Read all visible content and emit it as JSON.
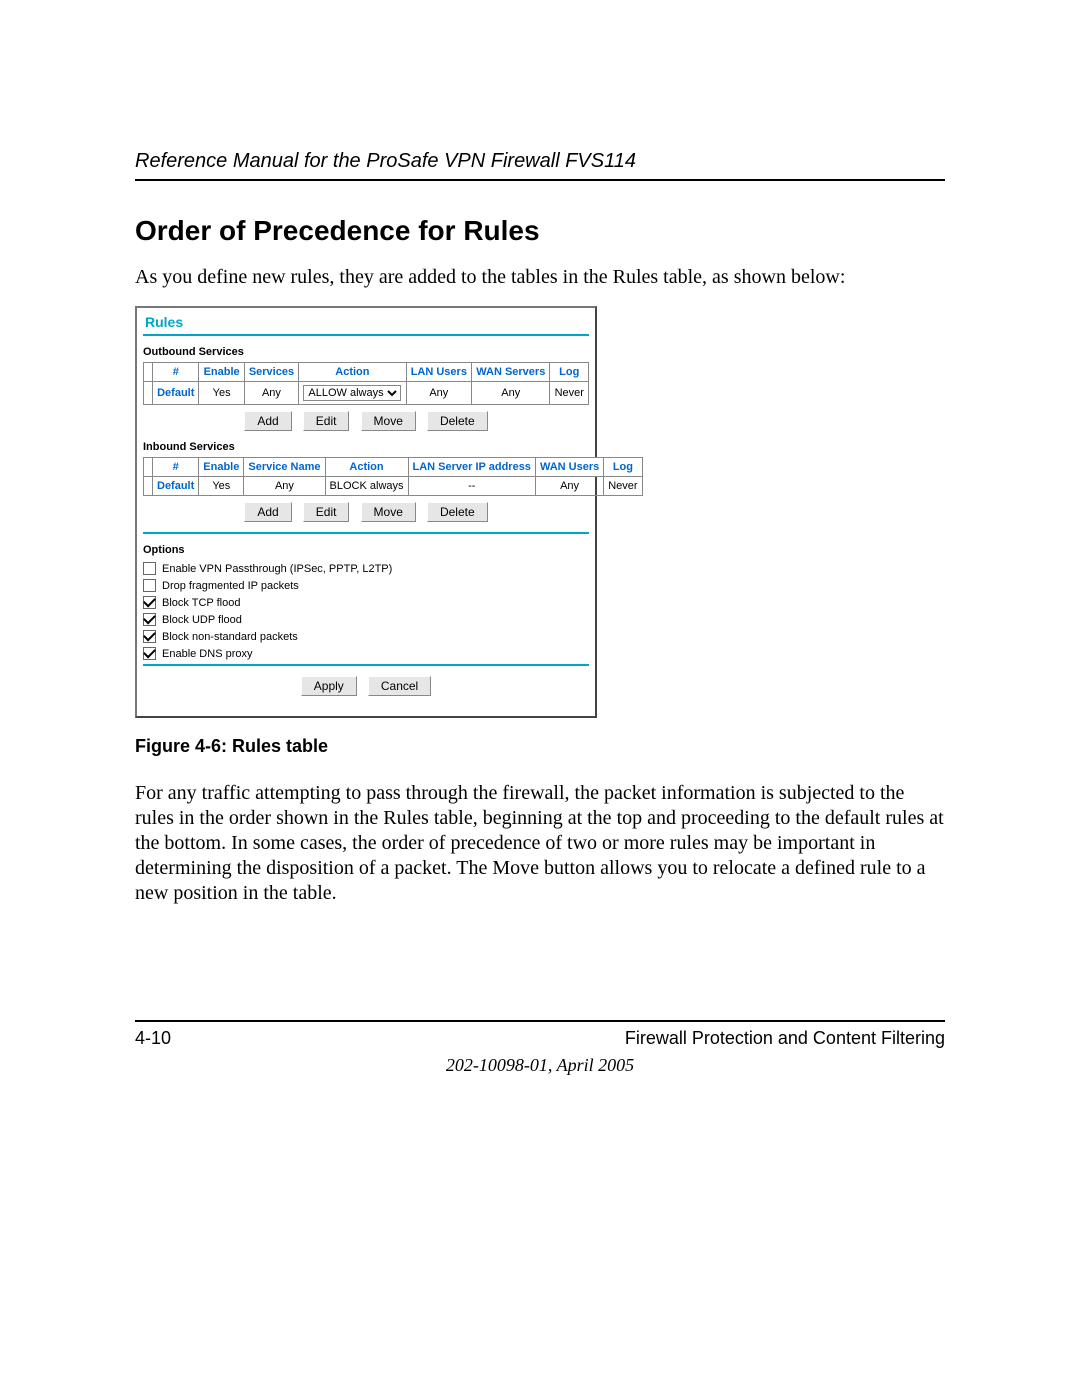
{
  "header": {
    "running_title": "Reference Manual for the ProSafe VPN Firewall FVS114"
  },
  "section": {
    "heading": "Order of Precedence for Rules",
    "intro": "As you define new rules, they are added to the tables in the Rules table, as shown below:",
    "body": "For any traffic attempting to pass through the firewall, the packet information is subjected to the rules in the order shown in the Rules table, beginning at the top and proceeding to the default rules at the bottom. In some cases, the order of precedence of two or more rules may be important in determining the disposition of a packet. The Move button allows you to relocate a defined rule to a new position in the table."
  },
  "figure": {
    "caption": "Figure 4-6:  Rules table"
  },
  "screenshot": {
    "title": "Rules",
    "outbound": {
      "label": "Outbound Services",
      "headers": [
        "",
        "#",
        "Enable",
        "Services",
        "Action",
        "LAN Users",
        "WAN Servers",
        "Log"
      ],
      "row": {
        "num": "Default",
        "enable": "Yes",
        "service": "Any",
        "action": "ALLOW always",
        "lan": "Any",
        "wan": "Any",
        "log": "Never"
      }
    },
    "inbound": {
      "label": "Inbound Services",
      "headers": [
        "",
        "#",
        "Enable",
        "Service Name",
        "Action",
        "LAN Server IP address",
        "WAN Users",
        "Log"
      ],
      "row": {
        "num": "Default",
        "enable": "Yes",
        "service": "Any",
        "action": "BLOCK always",
        "lan": "--",
        "wan": "Any",
        "log": "Never"
      }
    },
    "buttons": {
      "add": "Add",
      "edit": "Edit",
      "move": "Move",
      "delete": "Delete",
      "apply": "Apply",
      "cancel": "Cancel"
    },
    "options": {
      "label": "Options",
      "items": [
        {
          "checked": false,
          "label": "Enable VPN Passthrough (IPSec, PPTP, L2TP)"
        },
        {
          "checked": false,
          "label": "Drop fragmented IP packets"
        },
        {
          "checked": true,
          "label": "Block TCP flood"
        },
        {
          "checked": true,
          "label": "Block UDP flood"
        },
        {
          "checked": true,
          "label": "Block non-standard packets"
        },
        {
          "checked": true,
          "label": "Enable DNS proxy"
        }
      ]
    }
  },
  "footer": {
    "page": "4-10",
    "chapter": "Firewall Protection and Content Filtering",
    "docstamp": "202-10098-01, April 2005"
  }
}
